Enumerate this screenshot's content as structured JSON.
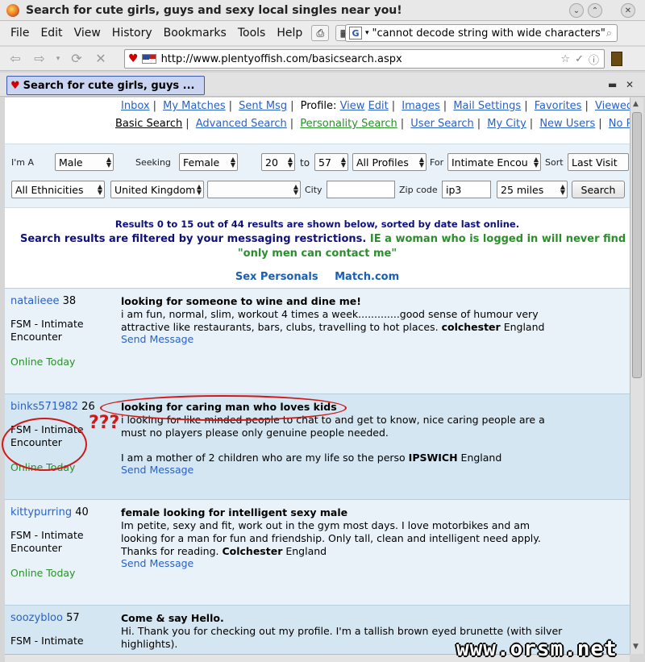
{
  "window": {
    "title": "Search for cute girls, guys and sexy local singles near you!"
  },
  "menu": {
    "items": [
      "File",
      "Edit",
      "View",
      "History",
      "Bookmarks",
      "Tools",
      "Help"
    ]
  },
  "search_box": {
    "value": "\"cannot decode string with wide characters\""
  },
  "url": "http://www.plentyoffish.com/basicsearch.aspx",
  "sidebar_tab": {
    "label": "Search for cute girls, guys ..."
  },
  "nav1": {
    "inbox": "Inbox",
    "my_matches": "My Matches",
    "sent_msg": "Sent Msg",
    "profile": "Profile:",
    "view": "View",
    "edit": "Edit",
    "images": "Images",
    "mail_settings": "Mail Settings",
    "favorites": "Favorites",
    "viewed": "Viewed"
  },
  "nav2": {
    "basic": "Basic Search",
    "advanced": "Advanced Search",
    "personality": "Personality Search",
    "user": "User Search",
    "mycity": "My City",
    "newusers": "New Users",
    "nophoto": "No P"
  },
  "form": {
    "im_a_label": "I'm A",
    "im_a": "Male",
    "seeking_label": "Seeking",
    "seeking": "Female",
    "age_from": "20",
    "to_label": "to",
    "age_to": "57",
    "profiles": "All Profiles",
    "for_label": "For",
    "for_value": "Intimate Encou",
    "sort_label": "Sort",
    "sort_value": "Last Visit",
    "ethnicity": "All Ethnicities",
    "country": "United Kingdom",
    "region": "",
    "city_label": "City",
    "city_value": "",
    "zip_label": "Zip code",
    "zip_value": "ip3",
    "distance": "25 miles",
    "search_button": "Search"
  },
  "results_info": "Results 0 to 15 out of 44 results are shown below, sorted by date last online.",
  "filter_note": "Search results are filtered by your messaging restrictions.",
  "filter_warning": "IE a woman who is logged in will never find her p",
  "only_men": "\"only men can contact me\"",
  "links": {
    "sex_personals": "Sex Personals",
    "match": "Match.com"
  },
  "results": [
    {
      "username": "natalieee",
      "age": "38",
      "intent": "FSM - Intimate Encounter",
      "online": "Online Today",
      "title": "looking for someone to wine and dine me!",
      "body": "i am fun, normal, slim, workout 4 times a week.............good sense of humour very attractive like restaurants, bars, clubs, travelling to hot places.",
      "city": "colchester",
      "country": "England",
      "send": "Send Message"
    },
    {
      "username": "binks571982",
      "age": "26",
      "intent": "FSM - Intimate Encounter",
      "online": "Online Today",
      "title": "looking for caring man who loves kids",
      "body": "i looking for like minded people to chat to and get to know, nice caring people are a must no players please only genuine people needed.",
      "body2": "I am a mother of 2 children who are my life so the perso",
      "city": "IPSWICH",
      "country": "England",
      "send": "Send Message"
    },
    {
      "username": "kittypurring",
      "age": "40",
      "intent": "FSM - Intimate Encounter",
      "online": "Online Today",
      "title": "female looking for intelligent sexy male",
      "body": "Im petite, sexy and fit, work out in the gym most days. I love motorbikes and am looking for a man for fun and friendship. Only tall, clean and intelligent need apply. Thanks for reading.",
      "city": "Colchester",
      "country": "England",
      "send": "Send Message"
    },
    {
      "username": "soozybloo",
      "age": "57",
      "intent": "FSM - Intimate",
      "title": "Come & say Hello.",
      "body": "Hi. Thank you for checking out my profile. I'm a tallish brown eyed brunette (with silver highlights)."
    }
  ],
  "annotation": {
    "marks": "???"
  },
  "watermark": "www.orsm.net"
}
